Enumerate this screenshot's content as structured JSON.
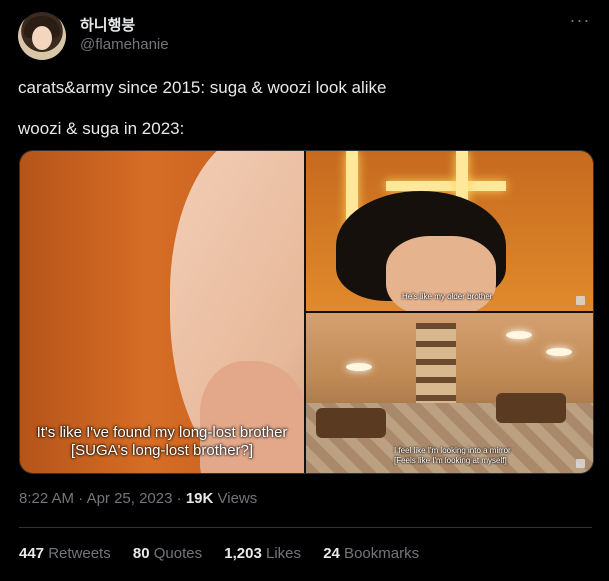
{
  "author": {
    "display_name": "하니행붕",
    "handle": "@flamehanie",
    "more_icon": "more-dots-icon"
  },
  "tweet": {
    "line1": "carats&army since 2015: suga & woozi look alike",
    "line2": "woozi & suga in 2023:"
  },
  "media": {
    "left_subtitle_line1": "It's like I've found my long-lost brother",
    "left_subtitle_line2": "[SUGA's long-lost brother?]",
    "top_right_subtitle": "He's like my older brother",
    "bottom_right_subtitle_line1": "I feel like I'm looking into a mirror",
    "bottom_right_subtitle_line2": "[Feels like I'm looking at myself]"
  },
  "meta": {
    "time": "8:22 AM",
    "sep1": " · ",
    "date": "Apr 25, 2023",
    "sep2": " · ",
    "views_count": "19K",
    "views_label": " Views"
  },
  "stats": {
    "retweets_count": "447",
    "retweets_label": " Retweets",
    "quotes_count": "80",
    "quotes_label": " Quotes",
    "likes_count": "1,203",
    "likes_label": " Likes",
    "bookmarks_count": "24",
    "bookmarks_label": " Bookmarks"
  }
}
